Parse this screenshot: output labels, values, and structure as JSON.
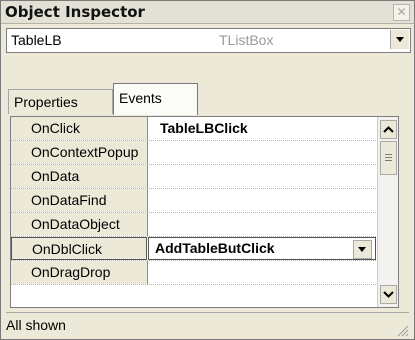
{
  "window": {
    "title": "Object Inspector",
    "close_glyph": "✕"
  },
  "component_selector": {
    "name": "TableLB",
    "class": "TListBox"
  },
  "tabs": [
    {
      "label": "Properties",
      "active": false
    },
    {
      "label": "Events",
      "active": true
    }
  ],
  "events": [
    {
      "name": "OnClick",
      "handler": "TableLBClick"
    },
    {
      "name": "OnContextPopup",
      "handler": ""
    },
    {
      "name": "OnData",
      "handler": ""
    },
    {
      "name": "OnDataFind",
      "handler": ""
    },
    {
      "name": "OnDataObject",
      "handler": ""
    },
    {
      "name": "OnDblClick",
      "handler": "AddTableButClick",
      "selected": true
    },
    {
      "name": "OnDragDrop",
      "handler": ""
    }
  ],
  "status": {
    "text": "All shown"
  },
  "icons": {
    "close": "close-icon",
    "dropdown": "chevron-down-icon",
    "scroll_up": "chevron-up-icon",
    "scroll_down": "chevron-down-icon",
    "resize": "resize-grip-icon"
  }
}
